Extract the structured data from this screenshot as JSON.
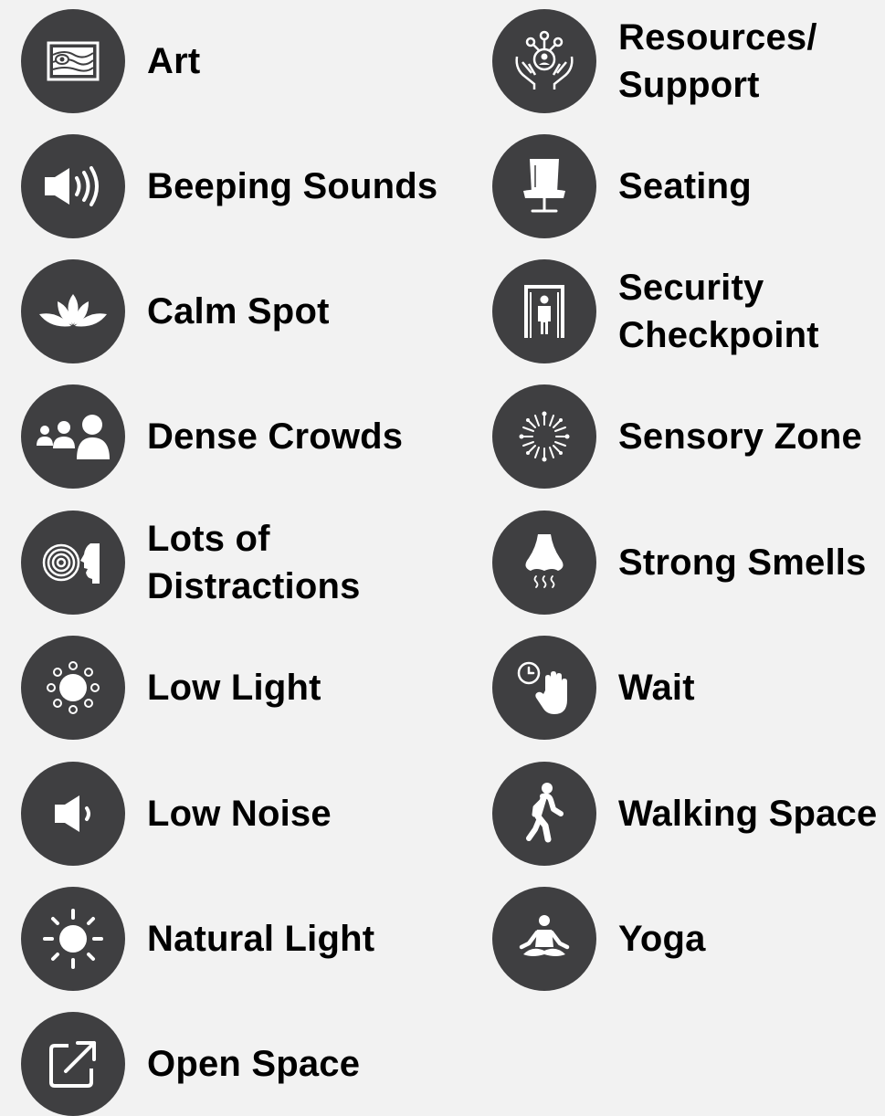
{
  "legend": {
    "left": [
      {
        "label": "Art",
        "icon": "art-icon"
      },
      {
        "label": "Beeping Sounds",
        "icon": "speaker-loud-icon"
      },
      {
        "label": "Calm Spot",
        "icon": "lotus-icon"
      },
      {
        "label": "Dense Crowds",
        "icon": "crowd-icon"
      },
      {
        "label": "Lots of\nDistractions",
        "icon": "distraction-spiral-icon"
      },
      {
        "label": "Low Light",
        "icon": "dim-sun-icon"
      },
      {
        "label": "Low Noise",
        "icon": "speaker-quiet-icon"
      },
      {
        "label": "Natural Light",
        "icon": "sun-icon"
      },
      {
        "label": "Open Space",
        "icon": "expand-arrow-icon"
      }
    ],
    "right": [
      {
        "label": "Resources/\nSupport",
        "icon": "support-hands-icon"
      },
      {
        "label": "Seating",
        "icon": "chair-icon"
      },
      {
        "label": "Security\nCheckpoint",
        "icon": "security-gate-icon"
      },
      {
        "label": "Sensory Zone",
        "icon": "sensory-burst-icon"
      },
      {
        "label": "Strong Smells",
        "icon": "nose-smell-icon"
      },
      {
        "label": "Wait",
        "icon": "wait-hand-clock-icon"
      },
      {
        "label": "Walking Space",
        "icon": "walking-person-icon"
      },
      {
        "label": "Yoga",
        "icon": "yoga-person-icon"
      }
    ]
  },
  "colors": {
    "icon_background": "#3f3f41",
    "icon_foreground": "#ffffff",
    "page_background": "#f2f2f2"
  }
}
